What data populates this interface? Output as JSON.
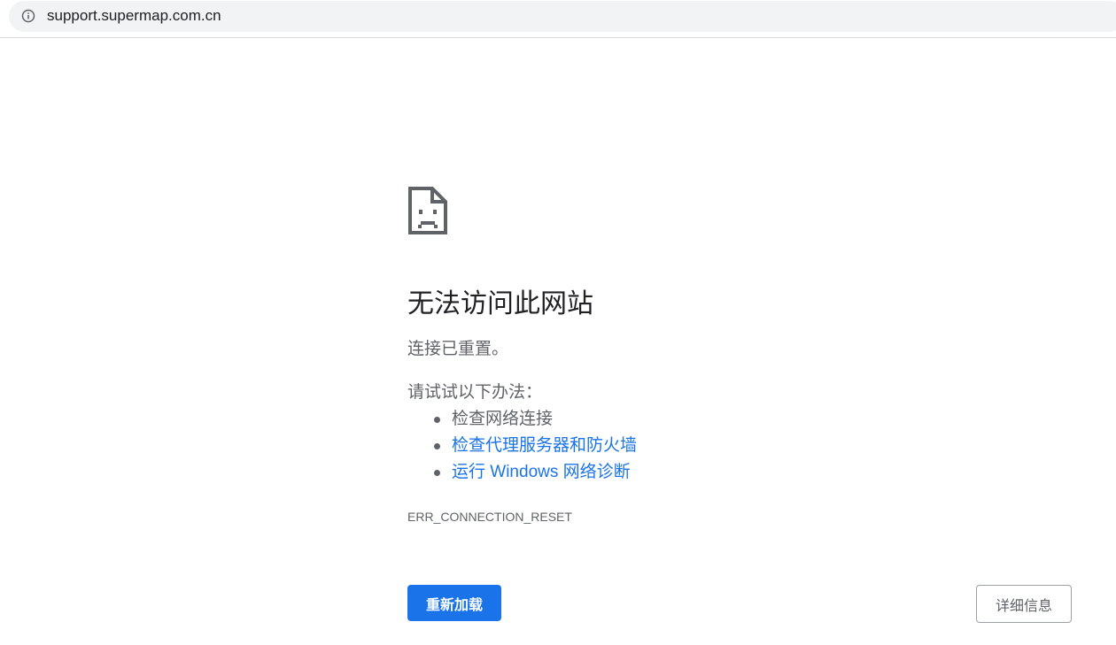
{
  "address_bar": {
    "icon": "info-icon",
    "url": "support.supermap.com.cn"
  },
  "error_page": {
    "icon": "sad-page-icon",
    "title": "无法访问此网站",
    "subtitle": "连接已重置。",
    "suggestions_heading": "请试试以下办法：",
    "suggestions": [
      {
        "label": "检查网络连接",
        "is_link": false
      },
      {
        "label": "检查代理服务器和防火墙",
        "is_link": true
      },
      {
        "label": "运行 Windows 网络诊断",
        "is_link": true
      }
    ],
    "error_code": "ERR_CONNECTION_RESET",
    "reload_button": "重新加载",
    "details_button": "详细信息"
  },
  "colors": {
    "accent": "#1a73e8",
    "text_primary": "#202124",
    "text_secondary": "#5f6368",
    "omnibox_bg": "#f1f3f4"
  }
}
